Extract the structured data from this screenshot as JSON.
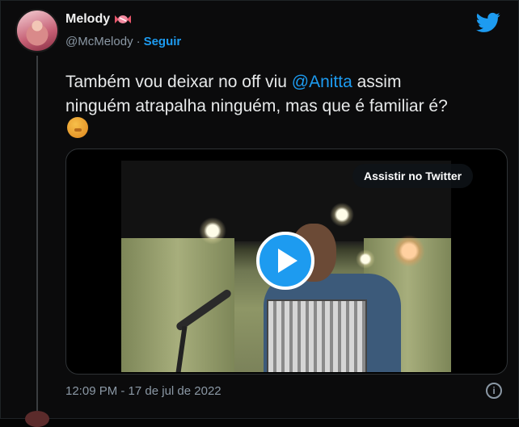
{
  "author": {
    "name": "Melody",
    "handle": "@McMelody",
    "separator": "·",
    "follow_label": "Seguir"
  },
  "tweet": {
    "line1_before": "Também vou deixar no off viu ",
    "mention": "@Anitta",
    "line1_after": "  assim",
    "line2": "ninguém atrapalha ninguém, mas que é familiar é?"
  },
  "media": {
    "watch_label": "Assistir no Twitter"
  },
  "footer": {
    "timestamp": "12:09 PM - 17 de jul de 2022",
    "info_glyph": "i"
  },
  "colors": {
    "accent": "#1d9bf0",
    "background": "#0b0b0c",
    "muted": "#8b98a5"
  },
  "icons": [
    "avatar",
    "candy-icon",
    "twitter-bird-icon",
    "emoji-icon",
    "play-icon",
    "info-icon"
  ]
}
